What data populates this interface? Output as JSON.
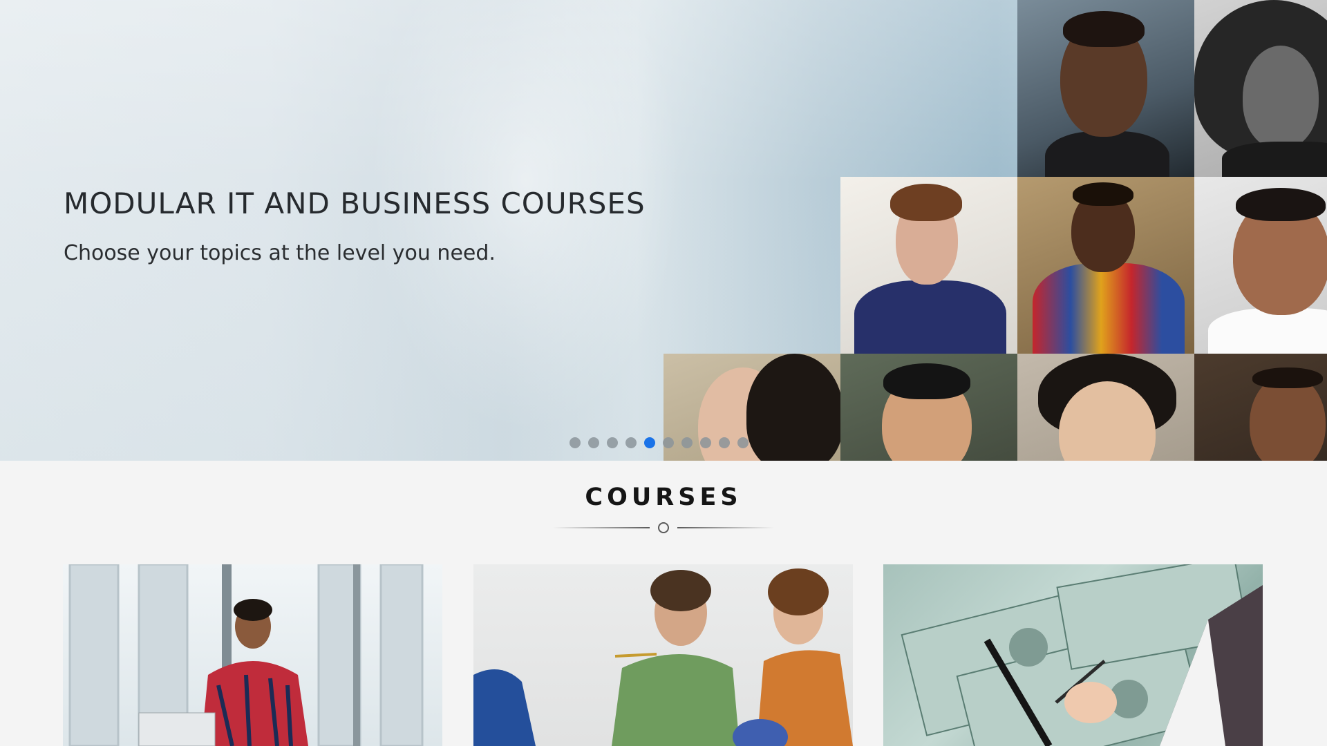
{
  "hero": {
    "title": "MODULAR IT AND BUSINESS COURSES",
    "subtitle": "Choose your topics at the level you need.",
    "slider": {
      "total_slides": 10,
      "active_index": 4
    },
    "colors": {
      "active_dot": "#1a73e8",
      "inactive_dot": "#8b949a"
    }
  },
  "courses": {
    "heading": "COURSES",
    "cards": [
      {
        "image": "student-with-laptop-photo"
      },
      {
        "image": "two-men-in-meeting-photo"
      },
      {
        "image": "dollar-bills-with-pen-photo"
      }
    ]
  }
}
